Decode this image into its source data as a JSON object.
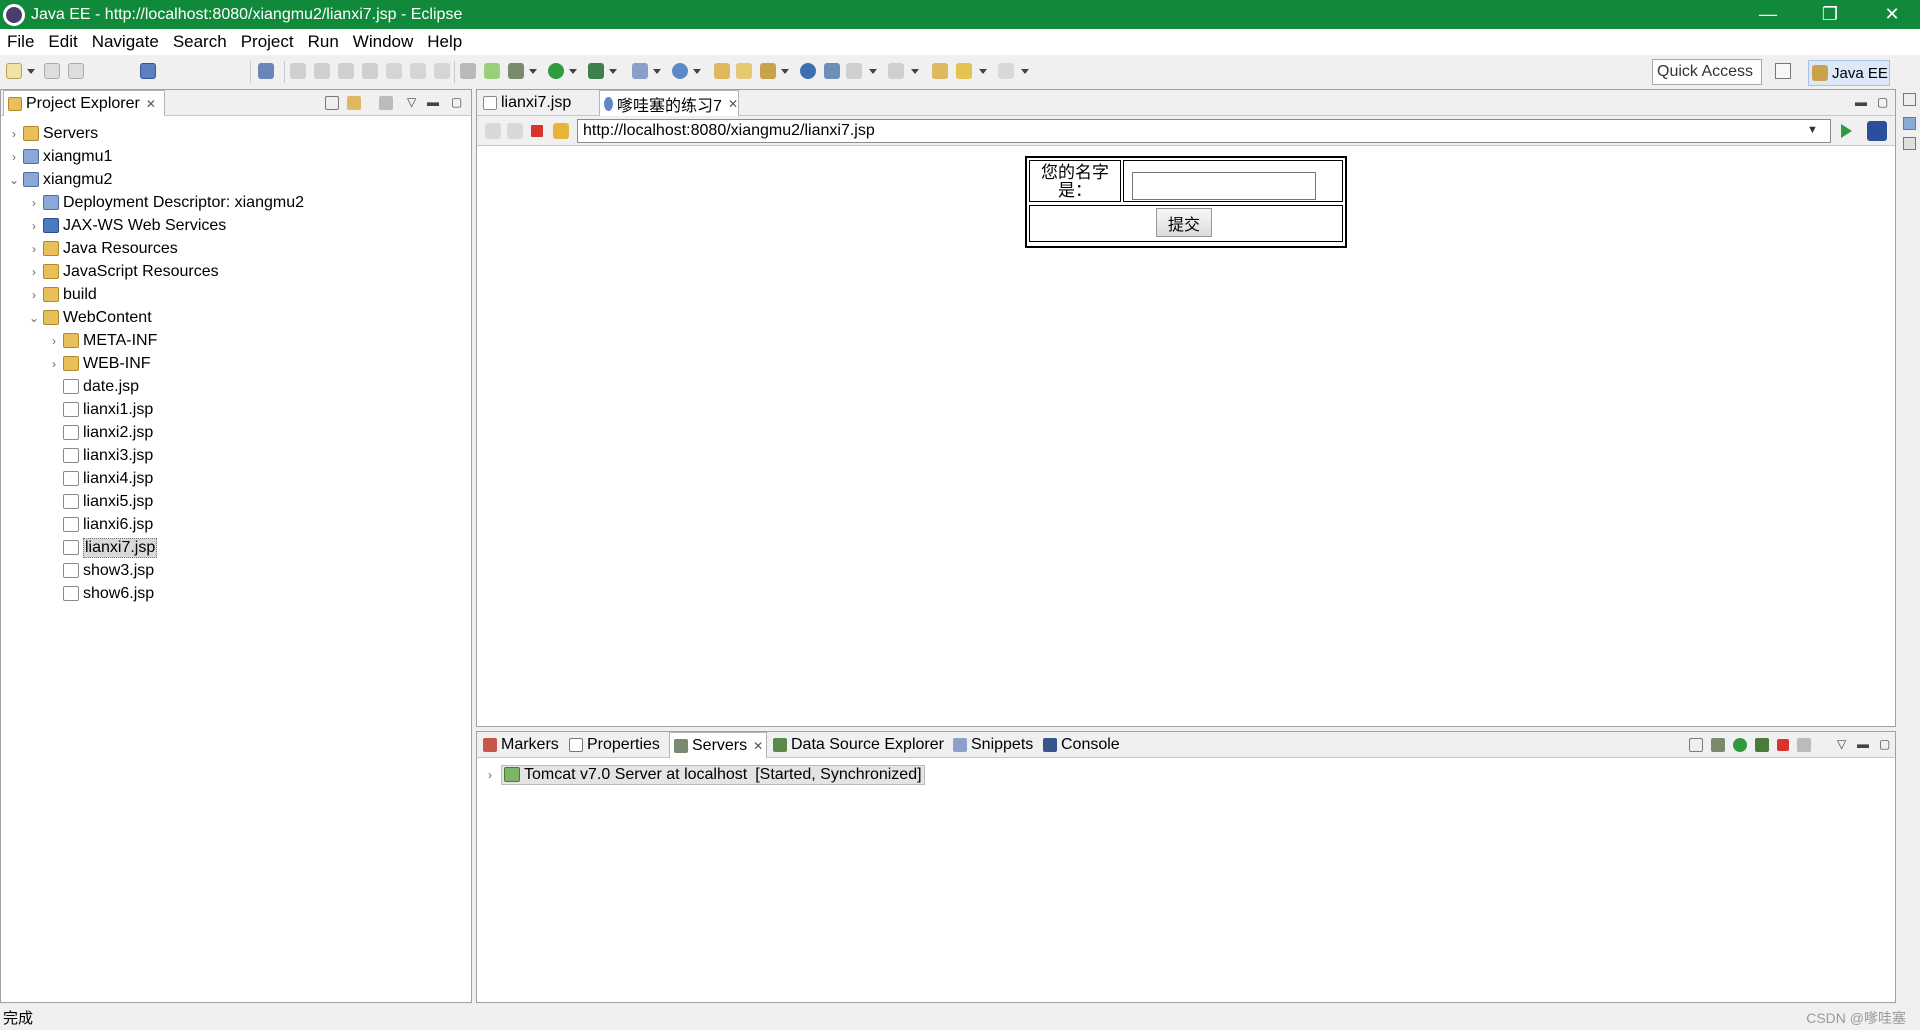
{
  "window": {
    "title": "Java EE - http://localhost:8080/xiangmu2/lianxi7.jsp - Eclipse",
    "minimize_glyph": "—",
    "restore_glyph": "❐",
    "close_glyph": "✕"
  },
  "menu": [
    "File",
    "Edit",
    "Navigate",
    "Search",
    "Project",
    "Run",
    "Window",
    "Help"
  ],
  "toolbar": {
    "quick_access": "Quick Access",
    "perspective": "Java EE"
  },
  "project_explorer": {
    "tab_label": "Project Explorer",
    "tree": [
      {
        "label": "Servers",
        "level": 0,
        "expander": "›",
        "icon": "folder-icon"
      },
      {
        "label": "xiangmu1",
        "level": 0,
        "expander": "›",
        "icon": "project-icon"
      },
      {
        "label": "xiangmu2",
        "level": 0,
        "expander": "⌄",
        "icon": "project-icon"
      },
      {
        "label": "Deployment Descriptor: xiangmu2",
        "level": 1,
        "expander": "›",
        "icon": "descriptor-icon"
      },
      {
        "label": "JAX-WS Web Services",
        "level": 1,
        "expander": "›",
        "icon": "webservice-icon"
      },
      {
        "label": "Java Resources",
        "level": 1,
        "expander": "›",
        "icon": "java-resources-icon"
      },
      {
        "label": "JavaScript Resources",
        "level": 1,
        "expander": "›",
        "icon": "javascript-icon"
      },
      {
        "label": "build",
        "level": 1,
        "expander": "›",
        "icon": "folder-icon"
      },
      {
        "label": "WebContent",
        "level": 1,
        "expander": "⌄",
        "icon": "folder-icon"
      },
      {
        "label": "META-INF",
        "level": 2,
        "expander": "›",
        "icon": "folder-icon"
      },
      {
        "label": "WEB-INF",
        "level": 2,
        "expander": "›",
        "icon": "folder-icon"
      },
      {
        "label": "date.jsp",
        "level": 2,
        "expander": "",
        "icon": "file-icon"
      },
      {
        "label": "lianxi1.jsp",
        "level": 2,
        "expander": "",
        "icon": "file-icon"
      },
      {
        "label": "lianxi2.jsp",
        "level": 2,
        "expander": "",
        "icon": "file-icon"
      },
      {
        "label": "lianxi3.jsp",
        "level": 2,
        "expander": "",
        "icon": "file-icon"
      },
      {
        "label": "lianxi4.jsp",
        "level": 2,
        "expander": "",
        "icon": "file-icon"
      },
      {
        "label": "lianxi5.jsp",
        "level": 2,
        "expander": "",
        "icon": "file-icon"
      },
      {
        "label": "lianxi6.jsp",
        "level": 2,
        "expander": "",
        "icon": "file-icon"
      },
      {
        "label": "lianxi7.jsp",
        "level": 2,
        "expander": "",
        "icon": "file-icon",
        "selected": true
      },
      {
        "label": "show3.jsp",
        "level": 2,
        "expander": "",
        "icon": "file-icon"
      },
      {
        "label": "show6.jsp",
        "level": 2,
        "expander": "",
        "icon": "file-icon"
      }
    ]
  },
  "editor": {
    "tabs": [
      {
        "label": "lianxi7.jsp",
        "active": false
      },
      {
        "label": "嗲哇塞的练习7",
        "active": true
      }
    ],
    "url": "http://localhost:8080/xiangmu2/lianxi7.jsp",
    "page": {
      "name_label": "您的名字是：",
      "submit_label": "提交"
    }
  },
  "bottom_panel": {
    "tabs": [
      "Markers",
      "Properties",
      "Servers",
      "Data Source Explorer",
      "Snippets",
      "Console"
    ],
    "active_tab": "Servers",
    "server_name": "Tomcat v7.0 Server at localhost",
    "server_status": "[Started, Synchronized]"
  },
  "status": {
    "text": "完成",
    "watermark": "CSDN @嗲哇塞"
  },
  "colors": {
    "titlebar": "#108a3a",
    "perspective_bg": "#dce8f7"
  }
}
